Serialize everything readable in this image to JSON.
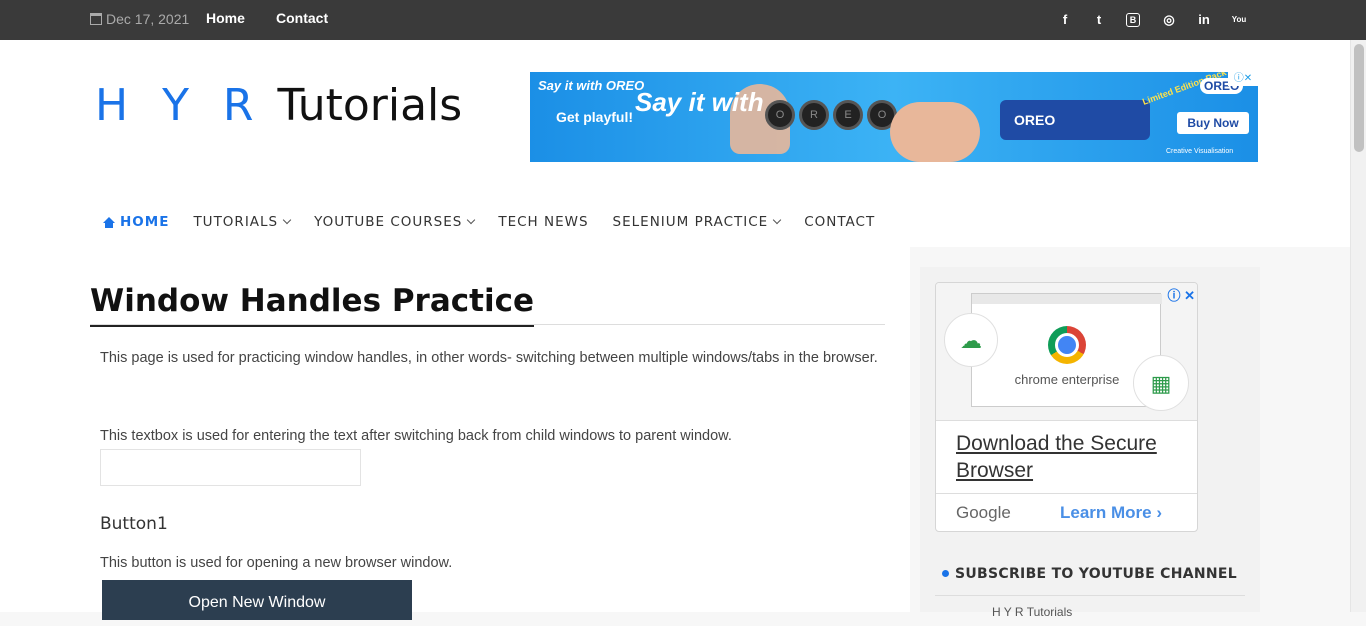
{
  "topbar": {
    "date": "Dec 17, 2021",
    "links": [
      "Home",
      "Contact"
    ],
    "social": {
      "facebook": "f",
      "twitter": "t",
      "blogger": "B",
      "instagram": "◎",
      "linkedin": "in",
      "youtube": "You"
    }
  },
  "logo": {
    "part1": "H Y R",
    "part2": " Tutorials"
  },
  "banner_ad": {
    "say_it_with": "Say it with OREO",
    "get_playful": "Get playful!",
    "headline": "Say it with",
    "cookie_letters": [
      "O",
      "R",
      "E",
      "O"
    ],
    "pack": "OREO",
    "limited": "Limited Edition Pack",
    "brand": "OREO",
    "buy_now": "Buy Now",
    "credit": "Creative Visualisation",
    "adchoice": "ⓘ✕"
  },
  "nav": {
    "home": "HOME",
    "tutorials": "TUTORIALS",
    "youtube_courses": "YOUTUBE COURSES",
    "tech_news": "TECH NEWS",
    "selenium_practice": "SELENIUM PRACTICE",
    "contact": "CONTACT"
  },
  "main": {
    "title": "Window Handles Practice",
    "intro": "This page is used for practicing window handles, in other words- switching between multiple windows/tabs in the browser.",
    "textbox_desc": "This textbox is used for entering the text after switching back from child windows to parent window.",
    "button1_heading": "Button1",
    "button1_desc": "This button is used for opening a new browser window.",
    "open_window_label": "Open New Window"
  },
  "sidebar": {
    "ad": {
      "adchoice": "ⓘ ✕",
      "product": "chrome enterprise",
      "headline": "Download the Secure Browser",
      "advertiser": "Google",
      "cta": "Learn More  ›"
    },
    "subscribe_heading": "SUBSCRIBE TO YOUTUBE CHANNEL",
    "snippet": "H Y R Tutorials"
  },
  "colors": {
    "accent": "#1a73e8",
    "topbar": "#3a3a3a",
    "button": "#2c3e50"
  }
}
